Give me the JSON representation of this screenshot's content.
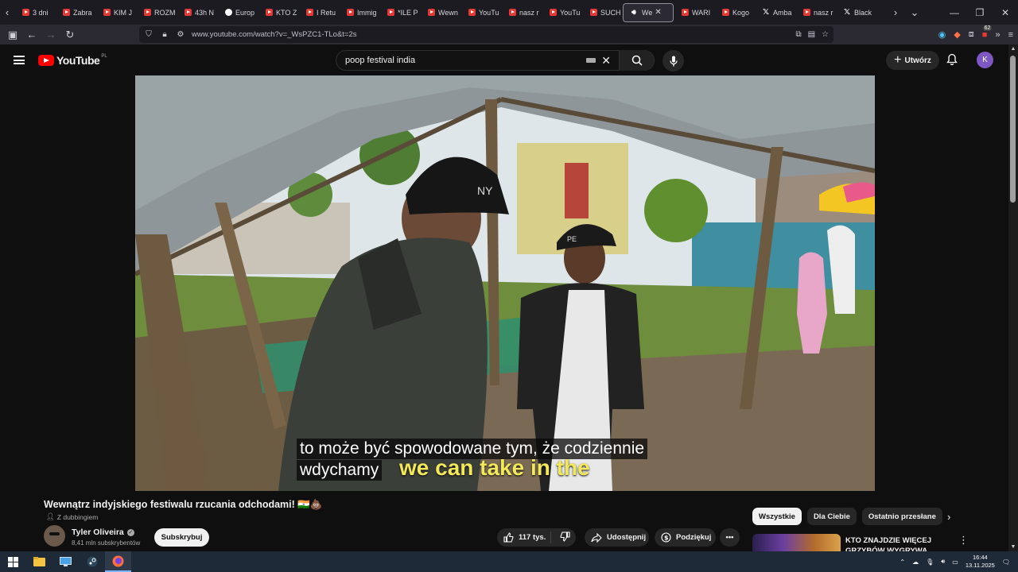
{
  "tabs": [
    {
      "label": "3 dni",
      "icon": "youtube-favicon"
    },
    {
      "label": "Zabra",
      "icon": "youtube-favicon"
    },
    {
      "label": "KIM J",
      "icon": "youtube-favicon"
    },
    {
      "label": "ROZM",
      "icon": "youtube-favicon"
    },
    {
      "label": "43h N",
      "icon": "youtube-favicon"
    },
    {
      "label": "Europ",
      "icon": "globe-favicon"
    },
    {
      "label": "KTO Z",
      "icon": "youtube-favicon"
    },
    {
      "label": "I Retu",
      "icon": "youtube-favicon"
    },
    {
      "label": "Immig",
      "icon": "youtube-favicon"
    },
    {
      "label": "*ILE P",
      "icon": "youtube-favicon"
    },
    {
      "label": "Wewn",
      "icon": "youtube-favicon"
    },
    {
      "label": "YouTu",
      "icon": "youtube-favicon"
    },
    {
      "label": "nasz r",
      "icon": "youtube-favicon"
    },
    {
      "label": "YouTu",
      "icon": "youtube-favicon"
    },
    {
      "label": "SUCH",
      "icon": "youtube-favicon"
    },
    {
      "label": "We",
      "icon": "speaker-icon",
      "active": true
    },
    {
      "label": "WARI",
      "icon": "youtube-favicon"
    },
    {
      "label": "Kogo",
      "icon": "youtube-favicon"
    },
    {
      "label": "Amba",
      "icon": "x-favicon"
    },
    {
      "label": "nasz r",
      "icon": "youtube-favicon"
    },
    {
      "label": "Black",
      "icon": "x-favicon"
    }
  ],
  "browser": {
    "url": "www.youtube.com/watch?v=_WsPZC1-TLo&t=2s",
    "extension_badge": "62"
  },
  "youtube": {
    "logo_text": "YouTube",
    "country_code": "PL",
    "search_query": "poop festival india",
    "create_label": "Utwórz",
    "avatar_letter": "K"
  },
  "video": {
    "subtitle_line1": "to może być spowodowane tym, że codziennie",
    "subtitle_line2": "wdychamy",
    "burned_caption": "we can take in the",
    "cap_text": "NY",
    "cap2_text": "PE",
    "title": "Wewnątrz indyjskiego festiwalu rzucania odchodami! 🇮🇳💩",
    "dubbing_label": "Z dubbingiem",
    "channel_name": "Tyler Oliveira",
    "subscribers": "8,41 mln subskrybentów",
    "subscribe_label": "Subskrybuj",
    "likes": "117 tys.",
    "share_label": "Udostępnij",
    "thanks_label": "Podziękuj"
  },
  "chips": [
    "Wszystkie",
    "Dla Ciebie",
    "Ostatnio przesłane"
  ],
  "recommendation": {
    "title": "KTO ZNAJDZIE WIĘCEJ GRZYBÓW WYGRYWA *AFERA*"
  },
  "taskbar": {
    "time": "16:44",
    "date": "13.11.2025"
  }
}
